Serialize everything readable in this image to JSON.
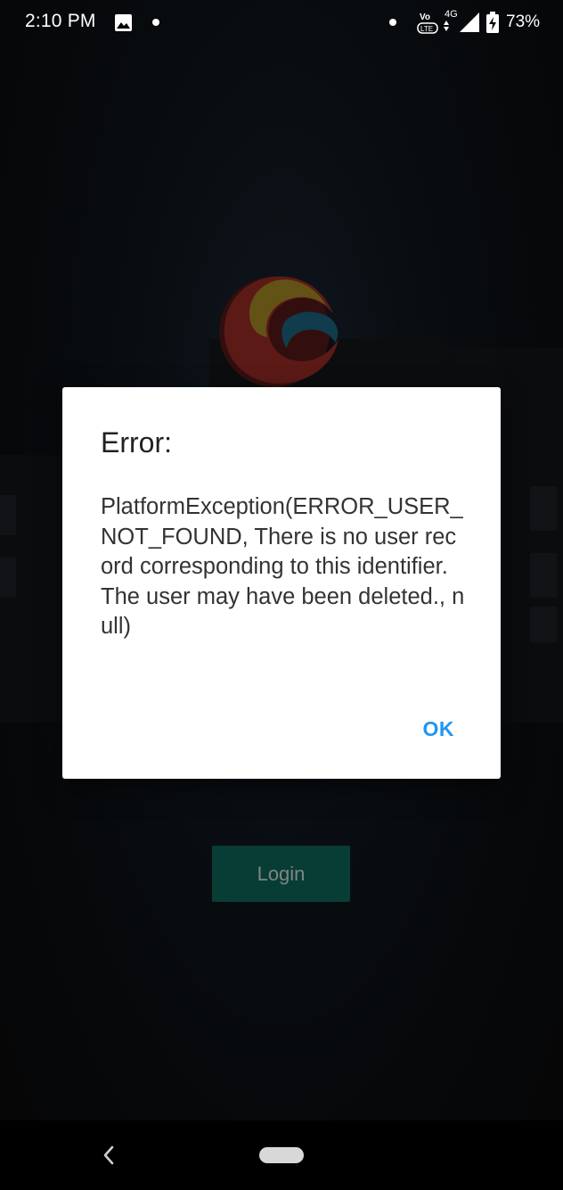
{
  "status_bar": {
    "time": "2:10 PM",
    "network": "4G",
    "battery": "73%",
    "icons": [
      "image-icon",
      "dot-icon",
      "volte-icon",
      "signal-icon",
      "battery-charging-icon"
    ]
  },
  "login": {
    "button_label": "Login",
    "accent": "#0f6f62"
  },
  "dialog": {
    "title": "Error:",
    "message": "PlatformException(ERROR_USER_NOT_FOUND, There is no user record corresponding to this identifier. The user may have been deleted., null)",
    "ok_label": "OK",
    "accent": "#2196F3"
  },
  "nav_bar": {
    "icons": [
      "back-icon",
      "home-pill-icon"
    ]
  }
}
